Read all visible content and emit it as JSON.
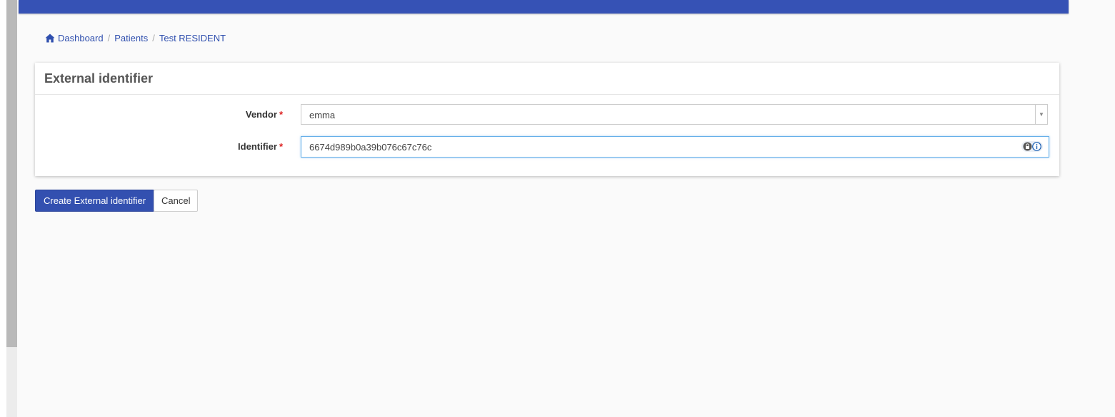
{
  "breadcrumb": {
    "items": [
      "Dashboard",
      "Patients",
      "Test RESIDENT"
    ],
    "separator": "/"
  },
  "card": {
    "title": "External identifier"
  },
  "form": {
    "vendor": {
      "label": "Vendor",
      "required_mark": "*",
      "value": "emma",
      "arrow": "▼"
    },
    "identifier": {
      "label": "Identifier",
      "required_mark": "*",
      "value": "6674d989b0a39b076c67c76c"
    }
  },
  "actions": {
    "create_label": "Create External identifier",
    "cancel_label": "Cancel"
  },
  "colors": {
    "brand": "#3652b5",
    "link": "#2f4fae",
    "required": "#dd2222"
  },
  "icons": {
    "home": "home-icon",
    "password_manager": "password-manager-icon",
    "info": "info-icon"
  }
}
